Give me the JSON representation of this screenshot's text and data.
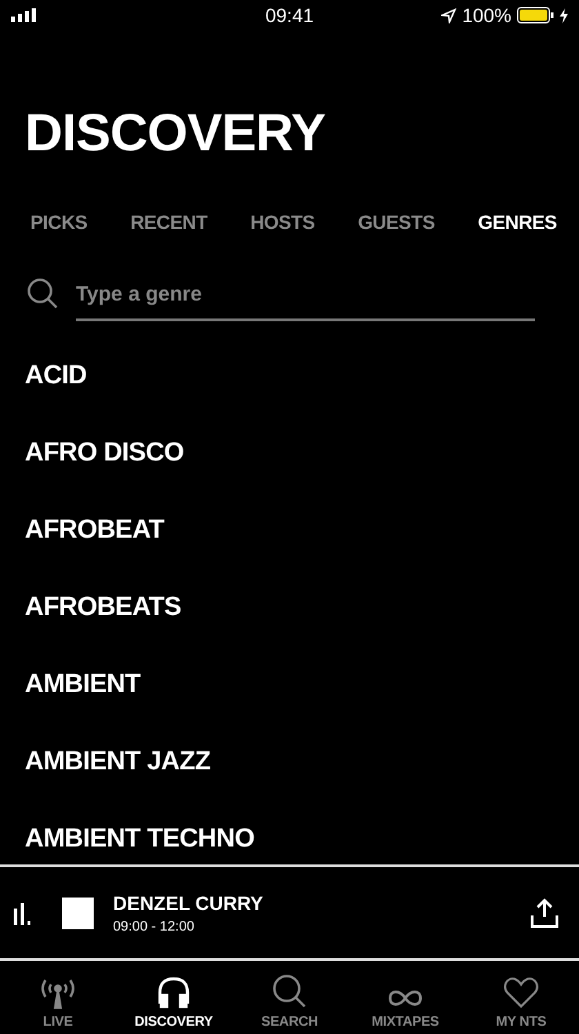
{
  "status_bar": {
    "time": "09:41",
    "battery": "100%"
  },
  "title": "DISCOVERY",
  "tabs": [
    {
      "label": "PICKS",
      "selected": false
    },
    {
      "label": "RECENT",
      "selected": false
    },
    {
      "label": "HOSTS",
      "selected": false
    },
    {
      "label": "GUESTS",
      "selected": false
    },
    {
      "label": "GENRES",
      "selected": true
    }
  ],
  "search": {
    "placeholder": "Type a genre"
  },
  "genres": [
    "ACID",
    "AFRO DISCO",
    "AFROBEAT",
    "AFROBEATS",
    "AMBIENT",
    "AMBIENT JAZZ",
    "AMBIENT TECHNO"
  ],
  "player": {
    "title": "DENZEL CURRY",
    "time": "09:00 - 12:00"
  },
  "nav": [
    {
      "label": "LIVE",
      "kind": "antenna",
      "selected": false
    },
    {
      "label": "DISCOVERY",
      "kind": "headphones",
      "selected": true
    },
    {
      "label": "SEARCH",
      "kind": "search",
      "selected": false
    },
    {
      "label": "MIXTAPES",
      "kind": "infinity",
      "selected": false
    },
    {
      "label": "MY NTS",
      "kind": "heart",
      "selected": false
    }
  ]
}
